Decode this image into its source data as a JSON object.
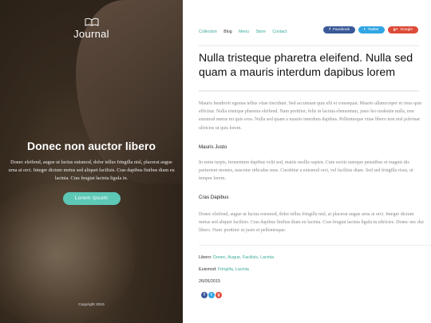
{
  "hero": {
    "logo_text": "Journal",
    "heading": "Donec non auctor libero",
    "text": "Donec eleifend, augue ut luctus euismod, dolor tellus fringilla nisl, placerat augue urna at orci. Integer dictum metus sed aliquet facilisis. Cras dapibus finibus diam eu lacinia. Cras feugiat lacinia ligula in.",
    "cta_label": "Lorem Ipsum",
    "copyright": "Copyright 2015"
  },
  "nav": [
    "Collection",
    "Blog",
    "Menu",
    "Store",
    "Contact"
  ],
  "share": {
    "facebook": "Facebook",
    "twitter": "Twitter",
    "google": "Google"
  },
  "article": {
    "title": "Nulla tristeque pharetra eleifend. Nulla sed quam a mauris interdum dapibus lorem",
    "para1": "Mauris hendrerit egestas tellus vitae tincidunt. Sed accumsan quis elit et consequat. Mauris ullamcorper et risus quis efficitur. Nulla tristique pharetra eleifend. Nam porttitor, felis in lacinia elementum, justo leo molestie nulla, non euismod metus mi quis eros. Nulla sed quam a mauris interdum dapibus. Pellentesque vitae libero non nisl pulvinar ultricies ut quis lorem.",
    "sub1": "Mauris Justo",
    "para2": "In enim turpis, fermentum dapibus velit sed, mattis mollis sapien. Cum sociis natoque penatibus et magnis dis parturient montes, nascetur ridiculus mus. Curabitur a euismod orci, vel facilisis diam. Sed sed fringilla risus, ut tempor lorem.",
    "sub2": "Cras Dapibus",
    "para3": "Donec eleifend, augue ut luctus euismod, dolor tellus fringilla nisl, at placerat augue urna at orci. Integer dictum metus sed aliquet facilisis. Cras dapibus finibus diam eu lacinia. Cras feugiat lacinia ligula in ultricies. Donec nec dui libero. Nunc porttitor ut justo et pellentesque."
  },
  "meta": {
    "libero_label": "Libero:",
    "libero_value": "Donec, Augue, Facilisis, Lacinia",
    "euismod_label": "Euismod:",
    "euismod_value": "Fringilla, Lacinia",
    "date": "26/05/2015"
  },
  "colors": {
    "accent": "#5ec8b7",
    "facebook": "#3b5998",
    "twitter": "#32a6e4",
    "google": "#dd4b39"
  }
}
